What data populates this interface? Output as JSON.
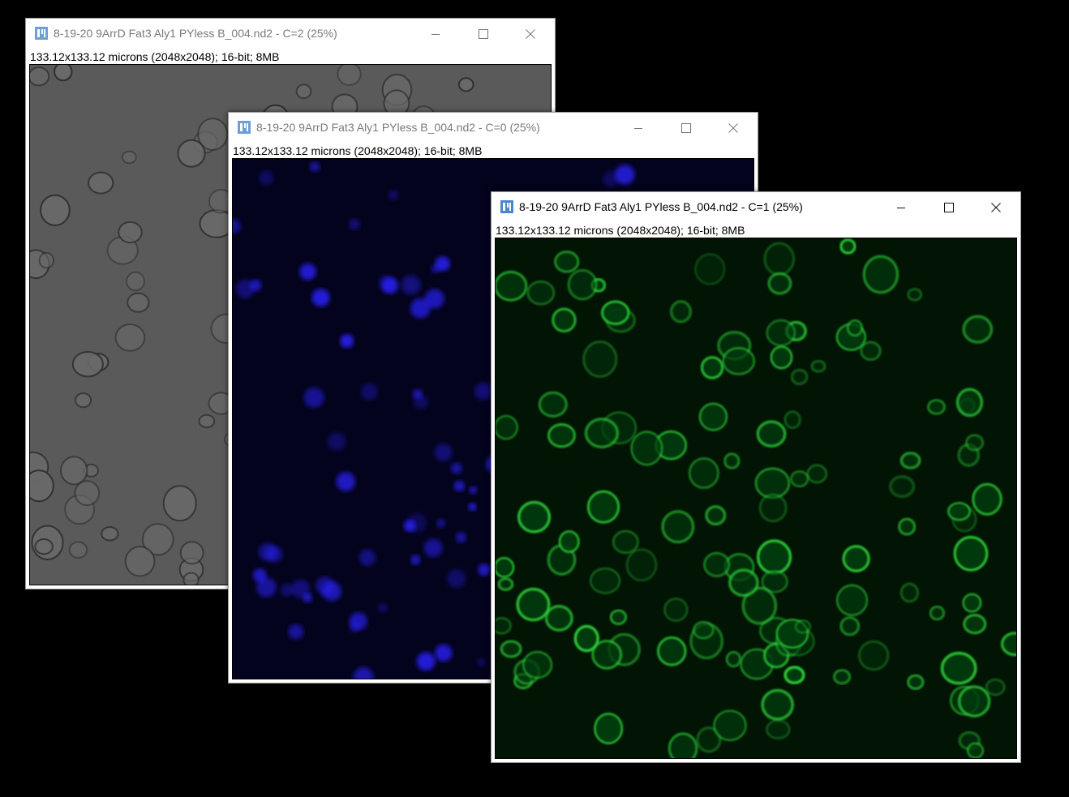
{
  "windows": [
    {
      "title": "8-19-20 9ArrD Fat3 Aly1 PYless B_004.nd2 - C=2 (25%)",
      "info": "133.12x133.12 microns (2048x2048); 16-bit; 8MB",
      "channel": "brightfield",
      "active": false
    },
    {
      "title": "8-19-20 9ArrD Fat3 Aly1 PYless B_004.nd2 - C=0 (25%)",
      "info": "133.12x133.12 microns (2048x2048); 16-bit; 8MB",
      "channel": "blue",
      "active": false
    },
    {
      "title": "8-19-20 9ArrD Fat3 Aly1 PYless B_004.nd2 - C=1 (25%)",
      "info": "133.12x133.12 microns (2048x2048); 16-bit; 8MB",
      "channel": "green",
      "active": true
    }
  ],
  "icons": {
    "app": "imagej-icon",
    "minimize": "minimize-icon",
    "maximize": "maximize-icon",
    "close": "close-icon"
  },
  "colors": {
    "desktop": "#000000",
    "brightfield_bg": "#5a5a5a",
    "blue_bg": "#04031e",
    "blue_cell": "#2a22ff",
    "green_bg": "#021404",
    "green_cell": "#2fd63a",
    "inactive_title": "#7a7a7a"
  }
}
